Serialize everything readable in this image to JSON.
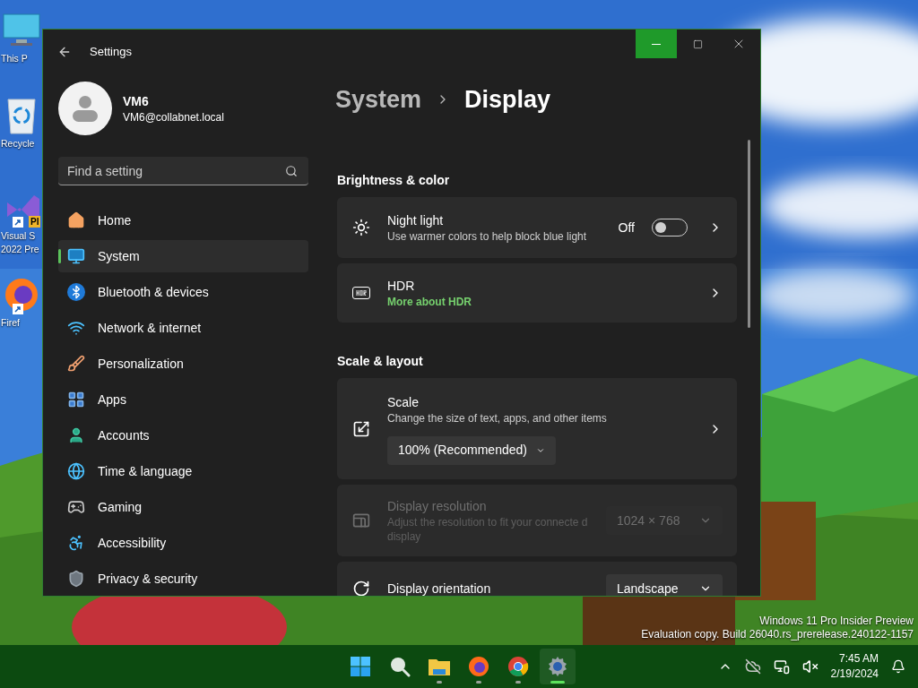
{
  "desktop": {
    "icons": [
      {
        "label_lines": [
          "This P"
        ]
      },
      {
        "label_lines": [
          "Recycle"
        ]
      },
      {
        "label_lines": [
          "Visual S",
          "2022 Pre"
        ],
        "badge": "PI",
        "shortcut": true
      },
      {
        "label_lines": [
          "Firef"
        ],
        "shortcut": true
      }
    ],
    "build_info": [
      "Windows 11 Pro Insider Preview",
      "Evaluation copy. Build 26040.rs_prerelease.240122-1157"
    ]
  },
  "window": {
    "title": "Settings",
    "controls": [
      {
        "kind": "minimize",
        "hovered": true
      },
      {
        "kind": "maximize",
        "hovered": false
      },
      {
        "kind": "close",
        "hovered": false
      }
    ],
    "account": {
      "name": "VM6",
      "email": "VM6@collabnet.local"
    },
    "search": {
      "placeholder": "Find a setting"
    },
    "nav": [
      {
        "label": "Home",
        "selected": false
      },
      {
        "label": "System",
        "selected": true
      },
      {
        "label": "Bluetooth & devices",
        "selected": false
      },
      {
        "label": "Network & internet",
        "selected": false
      },
      {
        "label": "Personalization",
        "selected": false
      },
      {
        "label": "Apps",
        "selected": false
      },
      {
        "label": "Accounts",
        "selected": false
      },
      {
        "label": "Time & language",
        "selected": false
      },
      {
        "label": "Gaming",
        "selected": false
      },
      {
        "label": "Accessibility",
        "selected": false
      },
      {
        "label": "Privacy & security",
        "selected": false
      }
    ],
    "breadcrumb": [
      "System",
      "Display"
    ],
    "sections": [
      {
        "heading": "Brightness & color",
        "cards": [
          {
            "kind": "toggle",
            "title": "Night light",
            "description": "Use warmer colors to help block blue light",
            "status": "Off",
            "on": false,
            "disabled": false
          },
          {
            "kind": "link",
            "title": "HDR",
            "link": "More about HDR",
            "disabled": false
          }
        ]
      },
      {
        "heading": "Scale & layout",
        "cards": [
          {
            "kind": "dropdown-below",
            "title": "Scale",
            "description": "Change the size of text, apps, and other items",
            "value": "100% (Recommended)",
            "disabled": false
          },
          {
            "kind": "dropdown",
            "title": "Display resolution",
            "description": "Adjust the resolution to fit your connecte d display",
            "value": "1024 × 768",
            "disabled": true
          },
          {
            "kind": "dropdown",
            "title": "Display orientation",
            "value": "Landscape",
            "disabled": false
          }
        ]
      }
    ]
  },
  "taskbar": {
    "apps": [
      {
        "kind": "start",
        "running": false,
        "active": false
      },
      {
        "kind": "search",
        "running": false,
        "active": false
      },
      {
        "kind": "explorer",
        "running": true,
        "active": false
      },
      {
        "kind": "firefox",
        "running": true,
        "active": false
      },
      {
        "kind": "chrome",
        "running": true,
        "active": false
      },
      {
        "kind": "settings",
        "running": true,
        "active": true
      }
    ],
    "clock": {
      "time": "7:45 AM",
      "date": "2/19/2024"
    }
  }
}
